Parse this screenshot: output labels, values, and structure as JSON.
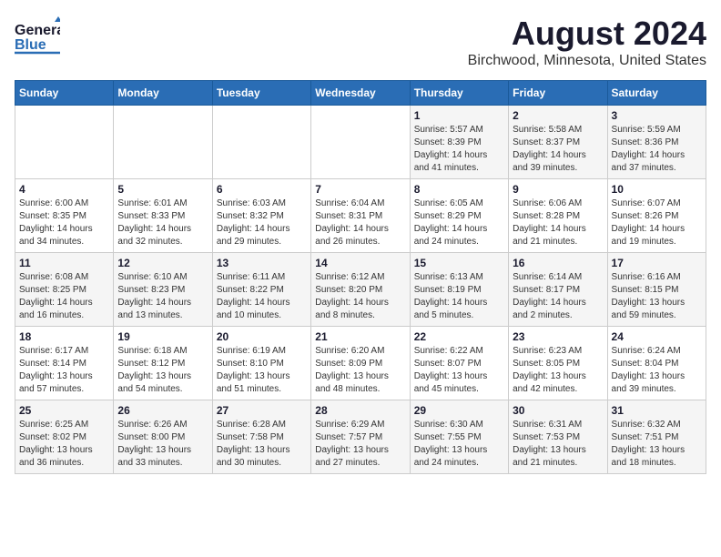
{
  "header": {
    "logo_general": "General",
    "logo_blue": "Blue",
    "title": "August 2024",
    "subtitle": "Birchwood, Minnesota, United States"
  },
  "weekdays": [
    "Sunday",
    "Monday",
    "Tuesday",
    "Wednesday",
    "Thursday",
    "Friday",
    "Saturday"
  ],
  "weeks": [
    [
      {
        "day": "",
        "info": ""
      },
      {
        "day": "",
        "info": ""
      },
      {
        "day": "",
        "info": ""
      },
      {
        "day": "",
        "info": ""
      },
      {
        "day": "1",
        "info": "Sunrise: 5:57 AM\nSunset: 8:39 PM\nDaylight: 14 hours\nand 41 minutes."
      },
      {
        "day": "2",
        "info": "Sunrise: 5:58 AM\nSunset: 8:37 PM\nDaylight: 14 hours\nand 39 minutes."
      },
      {
        "day": "3",
        "info": "Sunrise: 5:59 AM\nSunset: 8:36 PM\nDaylight: 14 hours\nand 37 minutes."
      }
    ],
    [
      {
        "day": "4",
        "info": "Sunrise: 6:00 AM\nSunset: 8:35 PM\nDaylight: 14 hours\nand 34 minutes."
      },
      {
        "day": "5",
        "info": "Sunrise: 6:01 AM\nSunset: 8:33 PM\nDaylight: 14 hours\nand 32 minutes."
      },
      {
        "day": "6",
        "info": "Sunrise: 6:03 AM\nSunset: 8:32 PM\nDaylight: 14 hours\nand 29 minutes."
      },
      {
        "day": "7",
        "info": "Sunrise: 6:04 AM\nSunset: 8:31 PM\nDaylight: 14 hours\nand 26 minutes."
      },
      {
        "day": "8",
        "info": "Sunrise: 6:05 AM\nSunset: 8:29 PM\nDaylight: 14 hours\nand 24 minutes."
      },
      {
        "day": "9",
        "info": "Sunrise: 6:06 AM\nSunset: 8:28 PM\nDaylight: 14 hours\nand 21 minutes."
      },
      {
        "day": "10",
        "info": "Sunrise: 6:07 AM\nSunset: 8:26 PM\nDaylight: 14 hours\nand 19 minutes."
      }
    ],
    [
      {
        "day": "11",
        "info": "Sunrise: 6:08 AM\nSunset: 8:25 PM\nDaylight: 14 hours\nand 16 minutes."
      },
      {
        "day": "12",
        "info": "Sunrise: 6:10 AM\nSunset: 8:23 PM\nDaylight: 14 hours\nand 13 minutes."
      },
      {
        "day": "13",
        "info": "Sunrise: 6:11 AM\nSunset: 8:22 PM\nDaylight: 14 hours\nand 10 minutes."
      },
      {
        "day": "14",
        "info": "Sunrise: 6:12 AM\nSunset: 8:20 PM\nDaylight: 14 hours\nand 8 minutes."
      },
      {
        "day": "15",
        "info": "Sunrise: 6:13 AM\nSunset: 8:19 PM\nDaylight: 14 hours\nand 5 minutes."
      },
      {
        "day": "16",
        "info": "Sunrise: 6:14 AM\nSunset: 8:17 PM\nDaylight: 14 hours\nand 2 minutes."
      },
      {
        "day": "17",
        "info": "Sunrise: 6:16 AM\nSunset: 8:15 PM\nDaylight: 13 hours\nand 59 minutes."
      }
    ],
    [
      {
        "day": "18",
        "info": "Sunrise: 6:17 AM\nSunset: 8:14 PM\nDaylight: 13 hours\nand 57 minutes."
      },
      {
        "day": "19",
        "info": "Sunrise: 6:18 AM\nSunset: 8:12 PM\nDaylight: 13 hours\nand 54 minutes."
      },
      {
        "day": "20",
        "info": "Sunrise: 6:19 AM\nSunset: 8:10 PM\nDaylight: 13 hours\nand 51 minutes."
      },
      {
        "day": "21",
        "info": "Sunrise: 6:20 AM\nSunset: 8:09 PM\nDaylight: 13 hours\nand 48 minutes."
      },
      {
        "day": "22",
        "info": "Sunrise: 6:22 AM\nSunset: 8:07 PM\nDaylight: 13 hours\nand 45 minutes."
      },
      {
        "day": "23",
        "info": "Sunrise: 6:23 AM\nSunset: 8:05 PM\nDaylight: 13 hours\nand 42 minutes."
      },
      {
        "day": "24",
        "info": "Sunrise: 6:24 AM\nSunset: 8:04 PM\nDaylight: 13 hours\nand 39 minutes."
      }
    ],
    [
      {
        "day": "25",
        "info": "Sunrise: 6:25 AM\nSunset: 8:02 PM\nDaylight: 13 hours\nand 36 minutes."
      },
      {
        "day": "26",
        "info": "Sunrise: 6:26 AM\nSunset: 8:00 PM\nDaylight: 13 hours\nand 33 minutes."
      },
      {
        "day": "27",
        "info": "Sunrise: 6:28 AM\nSunset: 7:58 PM\nDaylight: 13 hours\nand 30 minutes."
      },
      {
        "day": "28",
        "info": "Sunrise: 6:29 AM\nSunset: 7:57 PM\nDaylight: 13 hours\nand 27 minutes."
      },
      {
        "day": "29",
        "info": "Sunrise: 6:30 AM\nSunset: 7:55 PM\nDaylight: 13 hours\nand 24 minutes."
      },
      {
        "day": "30",
        "info": "Sunrise: 6:31 AM\nSunset: 7:53 PM\nDaylight: 13 hours\nand 21 minutes."
      },
      {
        "day": "31",
        "info": "Sunrise: 6:32 AM\nSunset: 7:51 PM\nDaylight: 13 hours\nand 18 minutes."
      }
    ]
  ]
}
